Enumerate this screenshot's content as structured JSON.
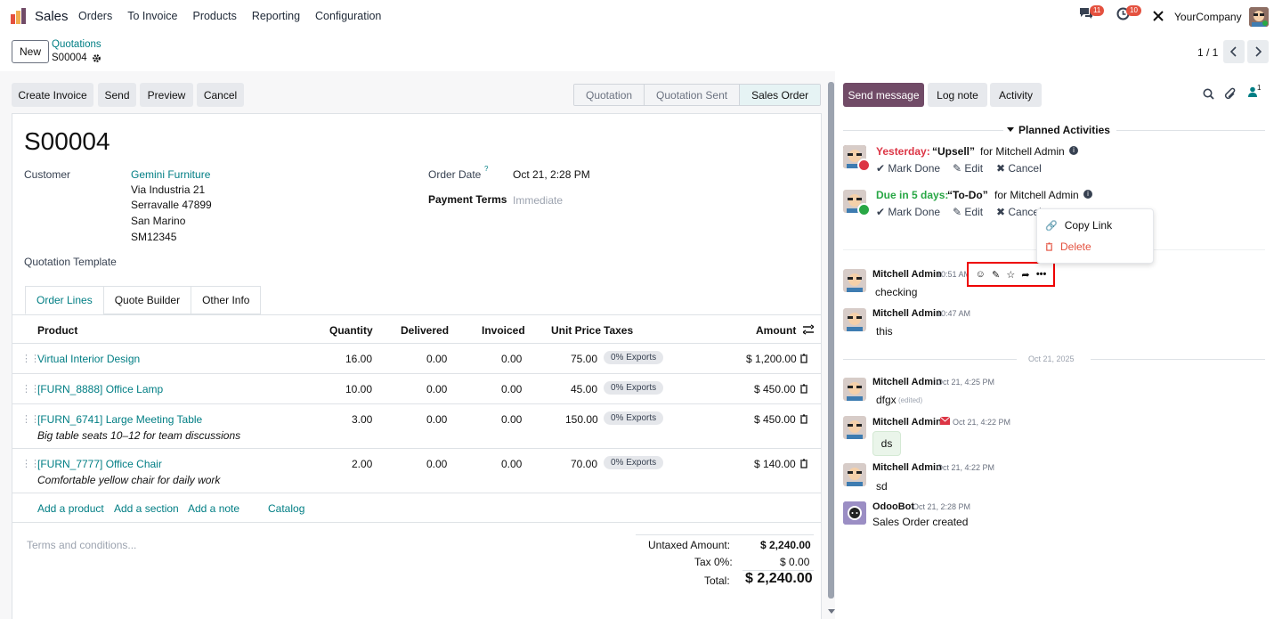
{
  "topbar": {
    "app_name": "Sales",
    "menu": [
      "Orders",
      "To Invoice",
      "Products",
      "Reporting",
      "Configuration"
    ],
    "messages_count": "11",
    "activities_count": "10",
    "company": "YourCompany"
  },
  "control_panel": {
    "new_label": "New",
    "breadcrumb_parent": "Quotations",
    "breadcrumb_current": "S00004",
    "pager": "1 / 1"
  },
  "actions": {
    "create_invoice": "Create Invoice",
    "send": "Send",
    "preview": "Preview",
    "cancel": "Cancel"
  },
  "statusbar": [
    "Quotation",
    "Quotation Sent",
    "Sales Order"
  ],
  "form": {
    "name": "S00004",
    "customer_label": "Customer",
    "customer_name": "Gemini Furniture",
    "address": [
      "Via Industria 21",
      "Serravalle 47899",
      "San Marino",
      "SM12345"
    ],
    "order_date_label": "Order Date",
    "order_date_help": "?",
    "order_date": "Oct 21, 2:28 PM",
    "payment_terms_label": "Payment Terms",
    "payment_terms_placeholder": "Immediate",
    "template_label": "Quotation Template"
  },
  "tabs": [
    "Order Lines",
    "Quote Builder",
    "Other Info"
  ],
  "table": {
    "headers": {
      "product": "Product",
      "quantity": "Quantity",
      "delivered": "Delivered",
      "invoiced": "Invoiced",
      "unit_price": "Unit Price",
      "taxes": "Taxes",
      "amount": "Amount"
    },
    "rows": [
      {
        "product": "Virtual Interior Design",
        "desc": "",
        "qty": "16.00",
        "delivered": "0.00",
        "invoiced": "0.00",
        "price": "75.00",
        "tax": "0% Exports",
        "amount": "$ 1,200.00"
      },
      {
        "product": "[FURN_8888] Office Lamp",
        "desc": "",
        "qty": "10.00",
        "delivered": "0.00",
        "invoiced": "0.00",
        "price": "45.00",
        "tax": "0% Exports",
        "amount": "$ 450.00"
      },
      {
        "product": "[FURN_6741] Large Meeting Table",
        "desc": "Big table seats 10–12 for team discussions",
        "qty": "3.00",
        "delivered": "0.00",
        "invoiced": "0.00",
        "price": "150.00",
        "tax": "0% Exports",
        "amount": "$ 450.00"
      },
      {
        "product": "[FURN_7777] Office Chair",
        "desc": "Comfortable yellow chair for daily work",
        "qty": "2.00",
        "delivered": "0.00",
        "invoiced": "0.00",
        "price": "70.00",
        "tax": "0% Exports",
        "amount": "$ 140.00"
      }
    ],
    "add_product": "Add a product",
    "add_section": "Add a section",
    "add_note": "Add a note",
    "catalog": "Catalog"
  },
  "footer": {
    "terms_placeholder": "Terms and conditions...",
    "untaxed_label": "Untaxed Amount:",
    "untaxed_value": "$ 2,240.00",
    "tax_label": "Tax 0%:",
    "tax_value": "$ 0.00",
    "total_label": "Total:",
    "total_value": "$ 2,240.00"
  },
  "chatter": {
    "send_message": "Send message",
    "log_note": "Log note",
    "activity": "Activity",
    "followers_count": "1",
    "planned_title": "Planned Activities",
    "activities": [
      {
        "when": "Yesterday:",
        "name": "“Upsell”",
        "for": "for Mitchell Admin"
      },
      {
        "when": "Due in 5 days:",
        "name": "“To-Do”",
        "for": "for Mitchell Admin"
      }
    ],
    "mark_done": "Mark Done",
    "edit": "Edit",
    "cancel": "Cancel",
    "dropdown": {
      "copy_link": "Copy Link",
      "delete": "Delete"
    },
    "date_separator": "Oct 21, 2025",
    "messages": [
      {
        "author": "Mitchell Admin",
        "time": "10:51 AM",
        "body": "checking"
      },
      {
        "author": "Mitchell Admin",
        "time": "10:47 AM",
        "body": "this"
      },
      {
        "author": "Mitchell Admin",
        "time": "Oct 21, 4:25 PM",
        "body": "dfgx",
        "edited": "(edited)"
      },
      {
        "author": "Mitchell Admin",
        "time": "Oct 21, 4:22 PM",
        "body": "ds"
      },
      {
        "author": "Mitchell Admin",
        "time": "Oct 21, 4:22 PM",
        "body": "sd"
      },
      {
        "author": "OdooBot",
        "time": "Oct 21, 2:28 PM",
        "body": "Sales Order created"
      }
    ]
  },
  "colors": {
    "accent": "#017e84",
    "primary": "#714b67",
    "danger": "#e4513f",
    "success": "#28a745"
  }
}
